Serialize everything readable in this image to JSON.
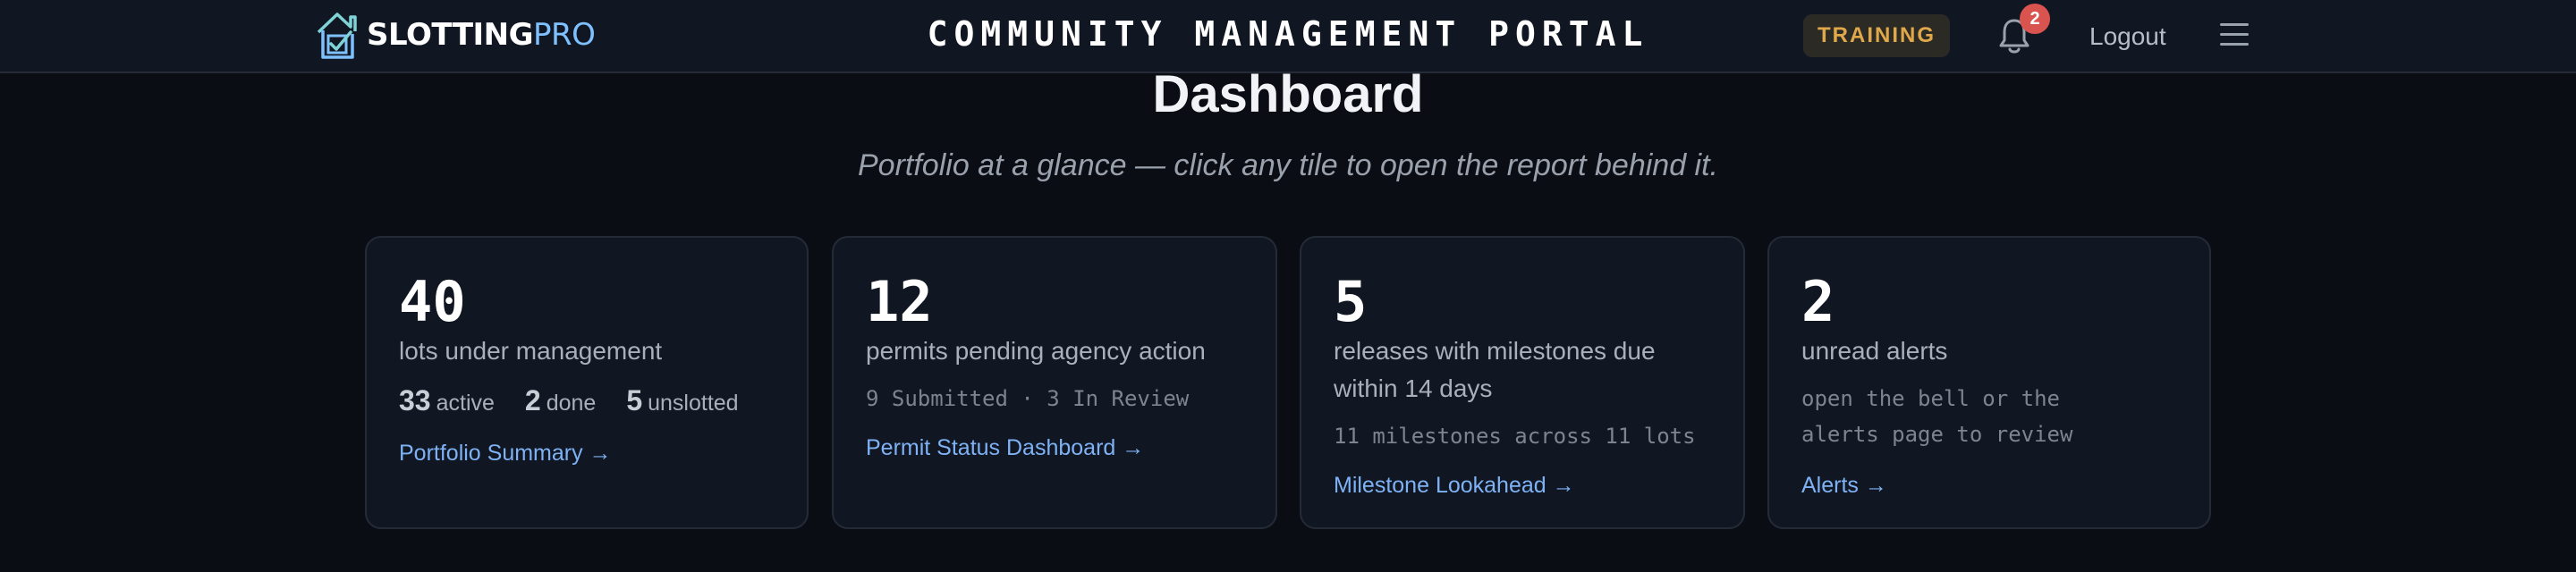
{
  "header": {
    "brand_primary": "SLOTTING",
    "brand_secondary": "PRO",
    "portal_title": "COMMUNITY MANAGEMENT PORTAL",
    "environment_badge": "TRAINING",
    "notification_count": "2",
    "logout_label": "Logout"
  },
  "page": {
    "title": "Dashboard",
    "subtitle": "Portfolio at a glance — click any tile to open the report behind it."
  },
  "tiles": [
    {
      "value": "40",
      "label": "lots under management",
      "stats": [
        {
          "num": "33",
          "label": "active"
        },
        {
          "num": "2",
          "label": "done"
        },
        {
          "num": "5",
          "label": "unslotted"
        }
      ],
      "link": "Portfolio Summary →"
    },
    {
      "value": "12",
      "label": "permits pending agency action",
      "meta": "9 Submitted · 3 In Review",
      "link": "Permit Status Dashboard →"
    },
    {
      "value": "5",
      "label": "releases with milestones due within 14 days",
      "meta": "11 milestones across 11 lots",
      "link": "Milestone Lookahead →"
    },
    {
      "value": "2",
      "label": "unread alerts",
      "meta": "open the bell or the alerts page to review",
      "link": "Alerts →"
    }
  ],
  "colors": {
    "background": "#0a0e14",
    "surface": "#111722",
    "accent_link": "#7eb2f5",
    "brand_accent": "#7fc0ff",
    "badge_text": "#e0a84a",
    "notification": "#d9534f"
  },
  "icons": [
    "house-check-logo-icon",
    "bell-icon",
    "hamburger-menu-icon",
    "arrow-right-icon"
  ]
}
